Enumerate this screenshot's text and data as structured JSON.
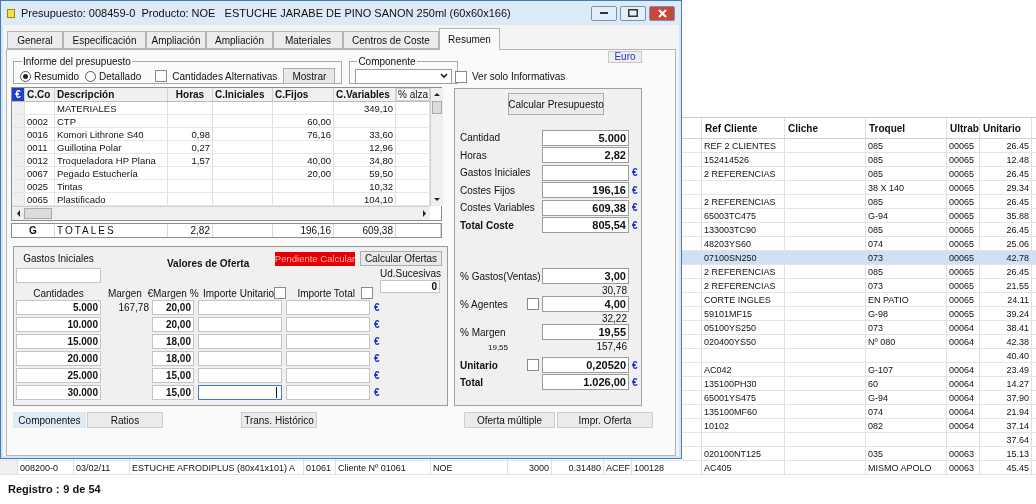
{
  "window": {
    "title": "Presupuesto: 008459-0  Producto: NOE   ESTUCHE JARABE DE PINO SANON 250ml (60x60x166)"
  },
  "tabs": [
    {
      "label": "General",
      "selected": false
    },
    {
      "label": "Especificación",
      "selected": false
    },
    {
      "label": "Ampliación",
      "selected": false
    },
    {
      "label": "Ampliación",
      "selected": false
    },
    {
      "label": "Materiales",
      "selected": false
    },
    {
      "label": "Centros de Coste",
      "selected": false
    },
    {
      "label": "Resumen",
      "selected": true
    }
  ],
  "informe": {
    "legend": "Informe del presupuesto",
    "options": [
      {
        "label": "Resumido",
        "selected": true
      },
      {
        "label": "Detallado",
        "selected": false
      }
    ],
    "alternatives": {
      "label": "Cantidades Alternativas",
      "checked": false
    },
    "button": "Mostrar"
  },
  "componente": {
    "legend": "Componente"
  },
  "euro_button": "Euro",
  "ver_solo": {
    "label": "Ver solo Informativas",
    "checked": false
  },
  "components_grid": {
    "columns": [
      "€",
      "C.Co",
      "Descripción",
      "Horas",
      "C.Iniciales",
      "C.Fijos",
      "C.Variables",
      "% alza"
    ],
    "rows": [
      {
        "description": "MATERIALES",
        "variables": "349,10"
      },
      {
        "code": "0002",
        "description": "CTP",
        "fijos": "60,00"
      },
      {
        "code": "0016",
        "description": "Komori Lithrone S40",
        "horas": "0,98",
        "fijos": "76,16",
        "variables": "33,60"
      },
      {
        "code": "0011",
        "description": "Guillotina Polar",
        "horas": "0,27",
        "variables": "12,96"
      },
      {
        "code": "0012",
        "description": "Troqueladora HP Plana",
        "horas": "1,57",
        "fijos": "40,00",
        "variables": "34,80"
      },
      {
        "code": "0067",
        "description": "Pegado Estuchería",
        "fijos": "20,00",
        "variables": "59,50"
      },
      {
        "code": "0025",
        "description": "Tintas",
        "variables": "10,32"
      },
      {
        "code": "0065",
        "description": "Plastificado",
        "variables": "104,10"
      }
    ],
    "totals": {
      "code": "G",
      "label": "TOTALES",
      "horas": "2,82",
      "fijos": "196,16",
      "variables": "609,38"
    }
  },
  "oferta": {
    "gastos_label": "Gastos Iniciales",
    "title": "Valores de Oferta",
    "status": "Pendiente Calcular",
    "calc_button": "Calcular Ofertas",
    "ud_label": "Ud.Sucesivas",
    "ud_value": "0",
    "columns": [
      "Cantidades",
      "Margen  €",
      "Margen %",
      "Importe Unitario",
      "Importe Total"
    ],
    "unit_checked": false,
    "total_checked": false,
    "rows": [
      {
        "cantidad": "5.000",
        "margen_eur": "167,78",
        "margen_pct": "20,00",
        "currency": "€",
        "focused": false
      },
      {
        "cantidad": "10.000",
        "margen_pct": "20,00",
        "currency": "€",
        "focused": false
      },
      {
        "cantidad": "15.000",
        "margen_pct": "18,00",
        "currency": "€",
        "focused": false
      },
      {
        "cantidad": "20.000",
        "margen_pct": "18,00",
        "currency": "€",
        "focused": false
      },
      {
        "cantidad": "25.000",
        "margen_pct": "15,00",
        "currency": "€",
        "focused": false
      },
      {
        "cantidad": "30.000",
        "margen_pct": "15,00",
        "currency": "€",
        "focused": true
      }
    ]
  },
  "summary": {
    "button": "Calcular Presupuesto",
    "costs": [
      {
        "label": "Cantidad",
        "value": "5.000"
      },
      {
        "label": "Horas",
        "value": "2,82"
      },
      {
        "label": "Gastos Iniciales",
        "currency": "€"
      },
      {
        "label": "Costes Fijos",
        "value": "196,16",
        "currency": "€"
      },
      {
        "label": "Costes Variables",
        "value": "609,38",
        "currency": "€"
      },
      {
        "label": "Total Coste",
        "value": "805,54",
        "currency": "€",
        "strong": true
      }
    ],
    "prices": [
      {
        "label": "% Gastos(Ventas)",
        "value": "3,00",
        "note": "30,78"
      },
      {
        "label": "% Agentes",
        "checked": false,
        "value": "4,00",
        "note": "32,22"
      },
      {
        "label": "% Margen",
        "value": "19,55",
        "side_note": "19,55",
        "note": "157,46"
      },
      {
        "label": "Unitario",
        "checked": false,
        "value": "0,20520",
        "currency": "€",
        "strong": true
      },
      {
        "label": "Total",
        "value": "1.026,00",
        "currency": "€",
        "strong": true
      }
    ]
  },
  "bottom_tabs": [
    {
      "label": "Componentes",
      "selected": true
    },
    {
      "label": "Ratios",
      "selected": false
    }
  ],
  "history_button": "Trans. Histórico",
  "offer_buttons": [
    "Oferta múltiple",
    "Impr. Oferta"
  ],
  "background_table": {
    "columns": [
      "Ref Cliente",
      "Cliche",
      "Troquel",
      "Ultrab",
      "Unitario"
    ],
    "rows": [
      {
        "cells": [
          "REF 2 CLIENTES",
          "",
          "085",
          "00065",
          "26.45"
        ],
        "selected": false
      },
      {
        "cells": [
          "152414526",
          "",
          "085",
          "00065",
          "12.48"
        ],
        "selected": false
      },
      {
        "cells": [
          "2 REFERENCIAS",
          "",
          "085",
          "00065",
          "26.45"
        ],
        "selected": false
      },
      {
        "cells": [
          "",
          "",
          "38 X 140",
          "00065",
          "29.34"
        ],
        "selected": false
      },
      {
        "cells": [
          "2 REFERENCIAS",
          "",
          "085",
          "00065",
          "26.45"
        ],
        "selected": false
      },
      {
        "cells": [
          "65003TC475",
          "",
          "G-94",
          "00065",
          "35.88"
        ],
        "selected": false
      },
      {
        "cells": [
          "133003TC90",
          "",
          "085",
          "00065",
          "26.45"
        ],
        "selected": false
      },
      {
        "cells": [
          "48203YS60",
          "",
          "074",
          "00065",
          "25.06"
        ],
        "selected": false
      },
      {
        "cells": [
          "07100SN250",
          "",
          "073",
          "00065",
          "42.78"
        ],
        "selected": true
      },
      {
        "cells": [
          "2 REFERENCIAS",
          "",
          "085",
          "00065",
          "26.45"
        ],
        "selected": false
      },
      {
        "cells": [
          "2 REFERENCIAS",
          "",
          "073",
          "00065",
          "21.55"
        ],
        "selected": false
      },
      {
        "cells": [
          "CORTE INGLES",
          "",
          "EN PATIO",
          "00065",
          "24.11"
        ],
        "selected": false
      },
      {
        "cells": [
          "59101MF15",
          "",
          "G-98",
          "00065",
          "39.24"
        ],
        "selected": false
      },
      {
        "cells": [
          "05100YS250",
          "",
          "073",
          "00064",
          "38.41"
        ],
        "selected": false
      },
      {
        "cells": [
          "020400YS50",
          "",
          "Nº 080",
          "00064",
          "42.38"
        ],
        "selected": false
      },
      {
        "cells": [
          "",
          "",
          "",
          "",
          "40.40"
        ],
        "selected": false
      },
      {
        "cells": [
          "AC042",
          "",
          "G-107",
          "00064",
          "23.49"
        ],
        "selected": false
      },
      {
        "cells": [
          "135100PH30",
          "",
          "60",
          "00064",
          "14.27"
        ],
        "selected": false
      },
      {
        "cells": [
          "65001YS475",
          "",
          "G-94",
          "00064",
          "37.90"
        ],
        "selected": false
      },
      {
        "cells": [
          "135100MF60",
          "",
          "074",
          "00064",
          "21.94"
        ],
        "selected": false
      },
      {
        "cells": [
          "10102",
          "",
          "082",
          "00064",
          "37.14"
        ],
        "selected": false
      },
      {
        "cells": [
          "",
          "",
          "",
          "",
          "37.64"
        ],
        "selected": false
      },
      {
        "cells": [
          "020100NT125",
          "",
          "035",
          "00063",
          "15.13"
        ],
        "selected": false
      },
      {
        "cells": [
          "AC405",
          "",
          "MISMO APOLO",
          "00063",
          "45.45"
        ],
        "selected": false,
        "leading_cells": [
          "008200-0",
          "03/02/11",
          "ESTUCHE AFRODIPLUS (80x41x101) A",
          "01061",
          "Cliente Nº 01061",
          "NOE",
          "3000",
          "0.31480",
          "ACEF",
          "100128"
        ]
      }
    ]
  },
  "status_bar": {
    "label": "Registro :",
    "value": "9 de 54"
  }
}
